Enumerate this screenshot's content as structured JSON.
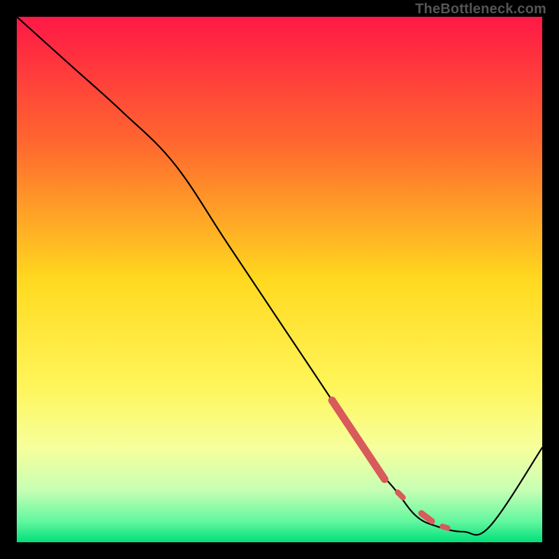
{
  "watermark": "TheBottleneck.com",
  "chart_data": {
    "type": "line",
    "title": "",
    "xlabel": "",
    "ylabel": "",
    "xlim": [
      0,
      100
    ],
    "ylim": [
      0,
      100
    ],
    "grid": false,
    "legend": false,
    "background_gradient": {
      "stops": [
        {
          "offset": 0.0,
          "color": "#ff1846"
        },
        {
          "offset": 0.25,
          "color": "#ff6b2e"
        },
        {
          "offset": 0.5,
          "color": "#ffd91f"
        },
        {
          "offset": 0.7,
          "color": "#fff559"
        },
        {
          "offset": 0.82,
          "color": "#f6ff9c"
        },
        {
          "offset": 0.9,
          "color": "#c8ffb4"
        },
        {
          "offset": 0.96,
          "color": "#63f79f"
        },
        {
          "offset": 1.0,
          "color": "#00e07a"
        }
      ]
    },
    "x": [
      0,
      10,
      20,
      30,
      40,
      50,
      60,
      67,
      72,
      76,
      80,
      85,
      90,
      100
    ],
    "values": [
      100,
      91,
      82,
      72,
      57,
      42,
      27,
      16,
      10,
      5,
      3,
      2,
      3,
      18
    ],
    "highlight_segments": [
      {
        "x0": 60,
        "y0": 27,
        "x1": 70,
        "y1": 12,
        "style": "thick"
      },
      {
        "x0": 72.5,
        "y0": 9.5,
        "x1": 73.5,
        "y1": 8.5,
        "style": "dot"
      },
      {
        "x0": 77,
        "y0": 5.5,
        "x1": 79,
        "y1": 4,
        "style": "dot-wide"
      },
      {
        "x0": 81,
        "y0": 3,
        "x1": 82,
        "y1": 2.7,
        "style": "dot"
      }
    ],
    "highlight_color": "#d85a5a"
  }
}
